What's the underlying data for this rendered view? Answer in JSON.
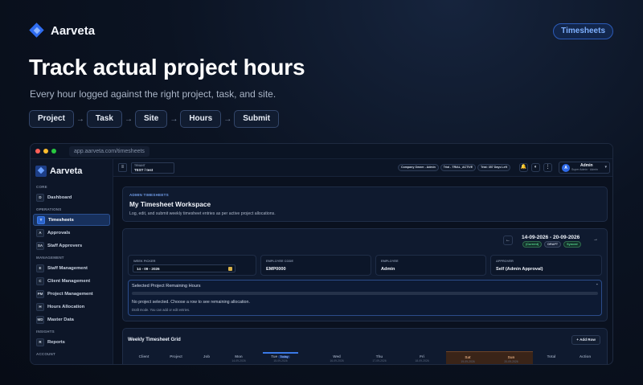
{
  "hero": {
    "brand": "Aarveta",
    "badge": "Timesheets",
    "title": "Track actual project hours",
    "subtitle": "Every hour logged against the right project, task, and site.",
    "flow": [
      "Project",
      "Task",
      "Site",
      "Hours",
      "Submit"
    ],
    "flow_arrow": "→"
  },
  "window": {
    "url": "app.aarveta.com/timesheets",
    "dots": [
      "#ff5f57",
      "#febc2e",
      "#28c840"
    ]
  },
  "sidebar": {
    "brand": "Aarveta",
    "sections": [
      {
        "title": "CORE",
        "items": [
          {
            "icon": "D",
            "label": "Dashboard",
            "active": false
          }
        ]
      },
      {
        "title": "OPERATIONS",
        "items": [
          {
            "icon": "T",
            "label": "Timesheets",
            "active": true
          },
          {
            "icon": "A",
            "label": "Approvals",
            "active": false
          },
          {
            "icon": "SA",
            "label": "Staff Approvers",
            "active": false
          }
        ]
      },
      {
        "title": "MANAGEMENT",
        "items": [
          {
            "icon": "E",
            "label": "Staff Management",
            "active": false
          },
          {
            "icon": "C",
            "label": "Client Management",
            "active": false
          },
          {
            "icon": "PM",
            "label": "Project Management",
            "active": false
          },
          {
            "icon": "H",
            "label": "Hours Allocation",
            "active": false
          },
          {
            "icon": "MD",
            "label": "Master Data",
            "active": false
          }
        ]
      },
      {
        "title": "INSIGHTS",
        "items": [
          {
            "icon": "R",
            "label": "Reports",
            "active": false
          }
        ]
      },
      {
        "title": "ACCOUNT",
        "items": []
      }
    ]
  },
  "topbar": {
    "menu_icon": "≡",
    "tenant_label": "TENANT",
    "tenant_value": "TEST / test",
    "chips": [
      "Company Owner - Admin",
      "Trial - TRIAL_ACTIVE",
      "Trial: 357 Days Left"
    ],
    "bell_icon": "🔔",
    "theme_icon": "◐",
    "more_icon": "⋮",
    "user_initial": "A",
    "user_name": "Admin",
    "user_role": "Super Admin · Admin",
    "caret": "▾"
  },
  "workspace": {
    "kicker": "ADMIN TIMESHEETS",
    "title": "My Timesheet Workspace",
    "description": "Log, edit, and submit weekly timesheet entries as per active project allocations."
  },
  "week": {
    "prev": "←",
    "next": "→",
    "range": "14-09-2026 - 20-09-2026",
    "tags": [
      "(Current)",
      "DRAFT",
      "Synced"
    ],
    "fields": {
      "week_picker_label": "WEEK PICKER",
      "week_picker_value": "14 - 09 - 2026",
      "emp_code_label": "EMPLOYEE CODE",
      "emp_code_value": "EMP0000",
      "employee_label": "EMPLOYEE",
      "employee_value": "Admin",
      "approver_label": "APPROVER",
      "approver_value": "Self (Admin Approval)"
    },
    "remaining": {
      "title": "Selected Project Remaining Hours",
      "collapse": "-",
      "message": "No project selected. Choose a row to see remaining allocation.",
      "note": "Draft mode. You can add or edit entries."
    }
  },
  "grid": {
    "title": "Weekly Timesheet Grid",
    "add_row": "+ Add Row",
    "columns": [
      {
        "label": "Client",
        "sub": ""
      },
      {
        "label": "Project",
        "sub": ""
      },
      {
        "label": "Job",
        "sub": ""
      },
      {
        "label": "Mon",
        "sub": "14-09-2026"
      },
      {
        "label": "Tue",
        "sub": "15-09-2026"
      },
      {
        "label": "Wed",
        "sub": "16-09-2026"
      },
      {
        "label": "Thu",
        "sub": "17-09-2026"
      },
      {
        "label": "Fri",
        "sub": "18-09-2026"
      },
      {
        "label": "Sat",
        "sub": "19-09-2026"
      },
      {
        "label": "Sun",
        "sub": "20-09-2026"
      },
      {
        "label": "Total",
        "sub": ""
      },
      {
        "label": "Action",
        "sub": ""
      }
    ],
    "today_badge": "Today"
  },
  "colors": {
    "accent": "#2f6ae8",
    "success": "#55d18e",
    "weekend": "#3a2418"
  }
}
